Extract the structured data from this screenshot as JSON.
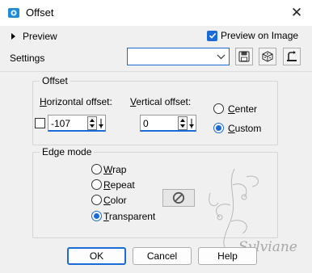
{
  "window": {
    "title": "Offset"
  },
  "top": {
    "preview_label": "Preview",
    "preview_on_image_label": "Preview on Image",
    "preview_on_image_checked": true,
    "settings_label": "Settings",
    "settings_value": ""
  },
  "offset_group": {
    "title": "Offset",
    "horizontal_label": "Horizontal offset:",
    "vertical_label": "Vertical offset:",
    "horizontal_value": "-107",
    "vertical_value": "0",
    "link_checked": false,
    "center_label": "Center",
    "custom_label": "Custom",
    "selected": "custom"
  },
  "edge_group": {
    "title": "Edge mode",
    "options": [
      "Wrap",
      "Repeat",
      "Color",
      "Transparent"
    ],
    "selected": "Transparent"
  },
  "buttons": {
    "ok": "OK",
    "cancel": "Cancel",
    "help": "Help"
  },
  "watermark": {
    "signature": "Sylviane"
  },
  "colors": {
    "accent": "#1a6bd6",
    "background": "#f0f0f0"
  }
}
